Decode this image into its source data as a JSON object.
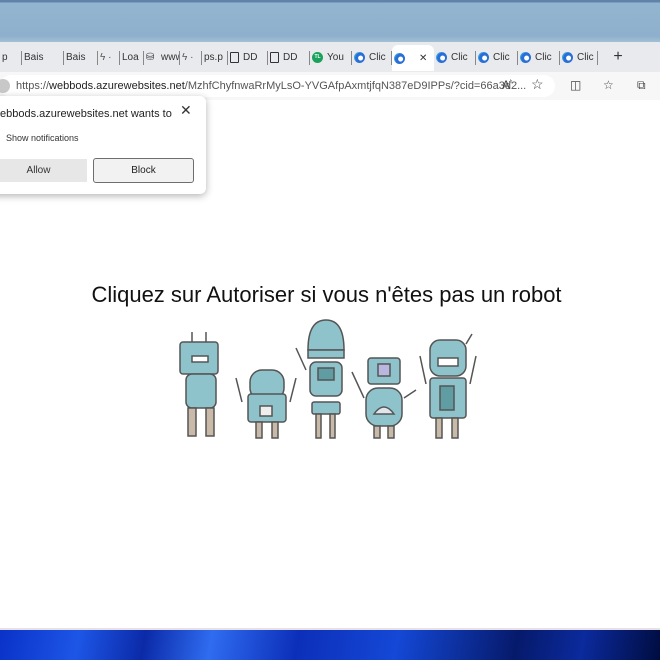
{
  "browser": {
    "tabs": [
      {
        "label": "p",
        "icon": "none"
      },
      {
        "label": "Bais",
        "icon": "none"
      },
      {
        "label": "Bais",
        "icon": "none"
      },
      {
        "label": "",
        "icon": "bolt-icon"
      },
      {
        "label": "Loa",
        "icon": "none"
      },
      {
        "label": "www",
        "icon": "download-icon"
      },
      {
        "label": "",
        "icon": "bolt-icon"
      },
      {
        "label": "ps.p",
        "icon": "none"
      },
      {
        "label": "DD",
        "icon": "document-icon"
      },
      {
        "label": "DD",
        "icon": "document-icon"
      },
      {
        "label": "You",
        "icon": "tl-icon"
      },
      {
        "label": "Clic",
        "icon": "edge-icon"
      },
      {
        "label": "",
        "icon": "edge-icon",
        "active": true
      },
      {
        "label": "Clic",
        "icon": "edge-icon"
      },
      {
        "label": "Clic",
        "icon": "edge-icon"
      },
      {
        "label": "Clic",
        "icon": "edge-icon"
      },
      {
        "label": "Clic",
        "icon": "edge-icon"
      }
    ],
    "new_tab": "+",
    "url_prefix": "https://",
    "url_host": "webbods.azurewebsites.net",
    "url_path": "/MzhfChyfnwaRrMyLsO-YVGAfpAxmtjfqN387eD9IPPs/?cid=66a3d2...",
    "toolbar_icons": [
      "read-aloud-icon",
      "favorite-star-icon",
      "split-screen-icon",
      "favorites-icon",
      "collections-icon"
    ]
  },
  "popup": {
    "title": "ebbods.azurewebsites.net wants to",
    "subtitle": "Show notifications",
    "allow": "Allow",
    "block": "Block",
    "close": "✕"
  },
  "page": {
    "headline": "Cliquez sur Autoriser si vous n'êtes pas un robot",
    "robot_color": "#8fc3cc"
  }
}
